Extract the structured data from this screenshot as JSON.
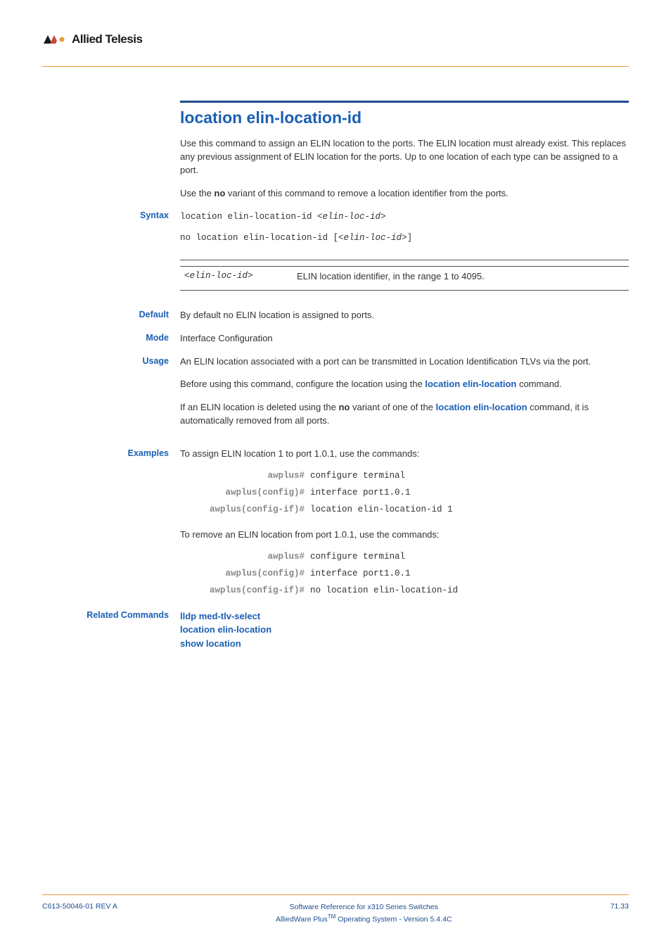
{
  "header": {
    "logo_text": "Allied Telesis"
  },
  "title": "location elin-location-id",
  "intro_para_1": "Use this command to assign an ELIN location to the ports. The ELIN location must already exist. This replaces any previous assignment of ELIN location for the ports. Up to one location of each type can be assigned to a port.",
  "intro_para_2_pre": "Use the ",
  "intro_para_2_bold": "no",
  "intro_para_2_post": " variant of this command to remove a location identifier from the ports.",
  "syntax": {
    "label": "Syntax",
    "line1_prefix": "location elin-location-id <",
    "line1_param": "elin-loc-id",
    "line1_suffix": ">",
    "line2_prefix": "no location elin-location-id [<",
    "line2_param": "elin-loc-id",
    "line2_suffix": ">]"
  },
  "param_table": {
    "name_prefix": "<",
    "name": "elin-loc-id",
    "name_suffix": ">",
    "desc": "ELIN location identifier, in the range 1 to 4095."
  },
  "default": {
    "label": "Default",
    "text": "By default no ELIN location is assigned to ports."
  },
  "mode": {
    "label": "Mode",
    "text": "Interface Configuration"
  },
  "usage": {
    "label": "Usage",
    "para1": "An ELIN location associated with a port can be transmitted in Location Identification TLVs via the port.",
    "para2_pre": "Before using this command, configure the location using the ",
    "para2_link": "location elin-location",
    "para2_post": " command.",
    "para3_pre": "If an ELIN location is deleted using the ",
    "para3_bold": "no",
    "para3_mid": " variant of one of the ",
    "para3_link": "location elin-location",
    "para3_post": " command, it is automatically removed from all ports."
  },
  "examples": {
    "label": "Examples",
    "intro1": "To assign ELIN location 1 to port 1.0.1, use the commands:",
    "block1": [
      {
        "prompt": "awplus#",
        "cmd": "configure terminal"
      },
      {
        "prompt": "awplus(config)#",
        "cmd": "interface port1.0.1"
      },
      {
        "prompt": "awplus(config-if)#",
        "cmd": "location elin-location-id 1"
      }
    ],
    "intro2": "To remove an ELIN location from port 1.0.1, use the commands:",
    "block2": [
      {
        "prompt": "awplus#",
        "cmd": "configure terminal"
      },
      {
        "prompt": "awplus(config)#",
        "cmd": "interface port1.0.1"
      },
      {
        "prompt": "awplus(config-if)#",
        "cmd": "no location elin-location-id"
      }
    ]
  },
  "related": {
    "label": "Related Commands",
    "items": [
      "lldp med-tlv-select",
      "location elin-location",
      "show location"
    ]
  },
  "footer": {
    "left": "C613-50046-01 REV A",
    "center_line1": "Software Reference for x310 Series Switches",
    "center_line2_pre": "AlliedWare Plus",
    "center_line2_tm": "TM",
    "center_line2_post": " Operating System - Version 5.4.4C",
    "right": "71.33"
  }
}
